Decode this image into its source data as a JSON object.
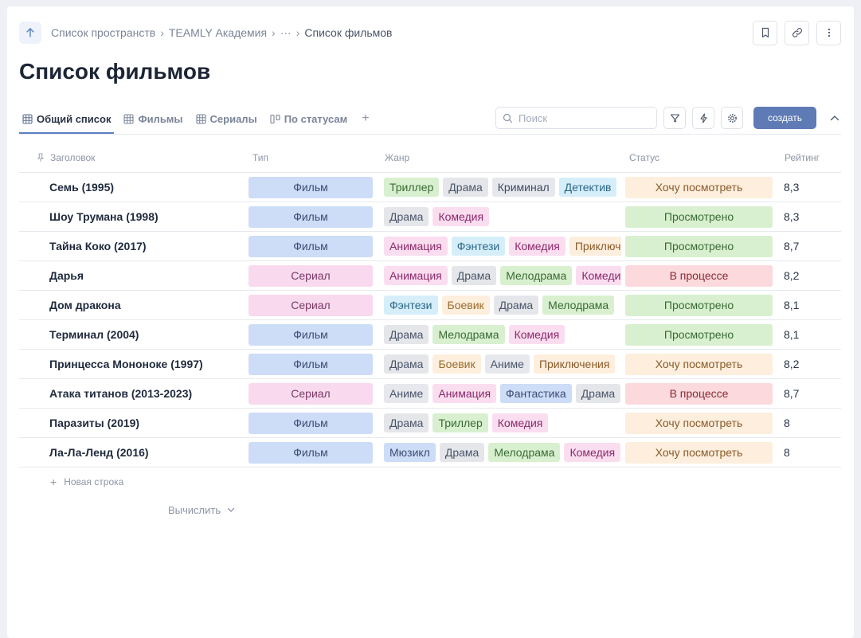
{
  "breadcrumb": {
    "items": [
      "Список пространств",
      "TEAMLY Академия",
      "···"
    ],
    "current": "Список фильмов"
  },
  "page_title": "Список фильмов",
  "tabs": [
    {
      "label": "Общий список",
      "icon": "table-icon",
      "active": true
    },
    {
      "label": "Фильмы",
      "icon": "table-icon",
      "active": false
    },
    {
      "label": "Сериалы",
      "icon": "table-icon",
      "active": false
    },
    {
      "label": "По статусам",
      "icon": "board-icon",
      "active": false
    }
  ],
  "toolbar": {
    "search_placeholder": "Поиск",
    "create_label": "создать"
  },
  "columns": {
    "title": "Заголовок",
    "type": "Тип",
    "genre": "Жанр",
    "status": "Статус",
    "rating": "Рейтинг"
  },
  "colors": {
    "accent": "#5f7bb5",
    "type_film": "#cddcf7",
    "type_series": "#f9d9ee",
    "status_want": "#fdeedd",
    "status_watched": "#d8f0cf",
    "status_progress": "#fbd9dc"
  },
  "rows": [
    {
      "title": "Семь (1995)",
      "type": "Фильм",
      "genres": [
        "Триллер",
        "Драма",
        "Криминал",
        "Детектив"
      ],
      "status": "Хочу посмотреть",
      "rating": "8,3"
    },
    {
      "title": "Шоу Трумана (1998)",
      "type": "Фильм",
      "genres": [
        "Драма",
        "Комедия"
      ],
      "status": "Просмотрено",
      "rating": "8,3"
    },
    {
      "title": "Тайна Коко (2017)",
      "type": "Фильм",
      "genres": [
        "Анимация",
        "Фэнтези",
        "Комедия",
        "Приключения"
      ],
      "status": "Просмотрено",
      "rating": "8,7"
    },
    {
      "title": "Дарья",
      "type": "Сериал",
      "genres": [
        "Анимация",
        "Драма",
        "Мелодрама",
        "Комедия"
      ],
      "status": "В процессе",
      "rating": "8,2"
    },
    {
      "title": "Дом дракона",
      "type": "Сериал",
      "genres": [
        "Фэнтези",
        "Боевик",
        "Драма",
        "Мелодрама"
      ],
      "status": "Просмотрено",
      "rating": "8,1"
    },
    {
      "title": "Терминал (2004)",
      "type": "Фильм",
      "genres": [
        "Драма",
        "Мелодрама",
        "Комедия"
      ],
      "status": "Просмотрено",
      "rating": "8,1"
    },
    {
      "title": "Принцесса Мононоке (1997)",
      "type": "Фильм",
      "genres": [
        "Драма",
        "Боевик",
        "Аниме",
        "Приключения"
      ],
      "status": "Хочу посмотреть",
      "rating": "8,2"
    },
    {
      "title": "Атака титанов (2013-2023)",
      "type": "Сериал",
      "genres": [
        "Аниме",
        "Анимация",
        "Фантастика",
        "Драма"
      ],
      "status": "В процессе",
      "rating": "8,7"
    },
    {
      "title": "Паразиты (2019)",
      "type": "Фильм",
      "genres": [
        "Драма",
        "Триллер",
        "Комедия"
      ],
      "status": "Хочу посмотреть",
      "rating": "8"
    },
    {
      "title": "Ла-Ла-Ленд (2016)",
      "type": "Фильм",
      "genres": [
        "Мюзикл",
        "Драма",
        "Мелодрама",
        "Комедия"
      ],
      "status": "Хочу посмотреть",
      "rating": "8"
    }
  ],
  "footer": {
    "new_row_label": "Новая строка",
    "calculate_label": "Вычислить"
  }
}
